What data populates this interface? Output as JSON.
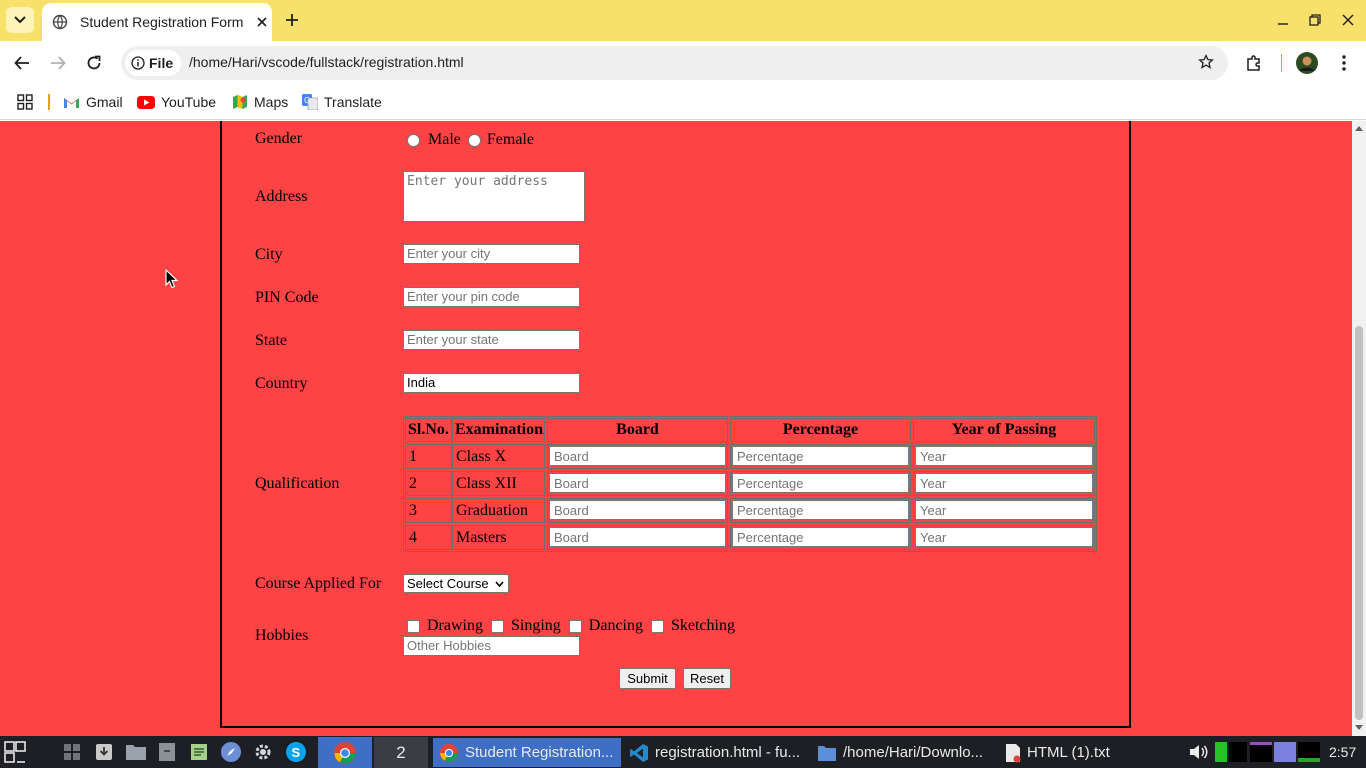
{
  "browser": {
    "tab_title": "Student Registration Form",
    "chip_label": "File",
    "url": "/home/Hari/vscode/fullstack/registration.html",
    "bookmarks": [
      "Gmail",
      "YouTube",
      "Maps",
      "Translate"
    ]
  },
  "form": {
    "gender": {
      "label": "Gender",
      "options": [
        "Male",
        "Female"
      ]
    },
    "address": {
      "label": "Address",
      "placeholder": "Enter your address"
    },
    "city": {
      "label": "City",
      "placeholder": "Enter your city"
    },
    "pin": {
      "label": "PIN Code",
      "placeholder": "Enter your pin code"
    },
    "state": {
      "label": "State",
      "placeholder": "Enter your state"
    },
    "country": {
      "label": "Country",
      "value": "India"
    },
    "qualification": {
      "label": "Qualification",
      "headers": [
        "Sl.No.",
        "Examination",
        "Board",
        "Percentage",
        "Year of Passing"
      ],
      "rows": [
        {
          "sl": "1",
          "exam": "Class X",
          "board": "Board",
          "percentage": "Percentage",
          "year": "Year"
        },
        {
          "sl": "2",
          "exam": "Class XII",
          "board": "Board",
          "percentage": "Percentage",
          "year": "Year"
        },
        {
          "sl": "3",
          "exam": "Graduation",
          "board": "Board",
          "percentage": "Percentage",
          "year": "Year"
        },
        {
          "sl": "4",
          "exam": "Masters",
          "board": "Board",
          "percentage": "Percentage",
          "year": "Year"
        }
      ]
    },
    "course": {
      "label": "Course Applied For",
      "selected": "Select Course"
    },
    "hobbies": {
      "label": "Hobbies",
      "options": [
        "Drawing",
        "Singing",
        "Dancing",
        "Sketching"
      ],
      "other_placeholder": "Other Hobbies"
    },
    "submit_label": "Submit",
    "reset_label": "Reset"
  },
  "taskbar": {
    "workspace": "2",
    "tasks": [
      "Student Registration...",
      "registration.html - fu...",
      "/home/Hari/Downlo...",
      "HTML (1).txt"
    ],
    "clock": "2:57"
  },
  "colors": {
    "page_bg": "#fd4344",
    "tabbar": "#f7e16b",
    "taskbar": "#1d1f24"
  }
}
